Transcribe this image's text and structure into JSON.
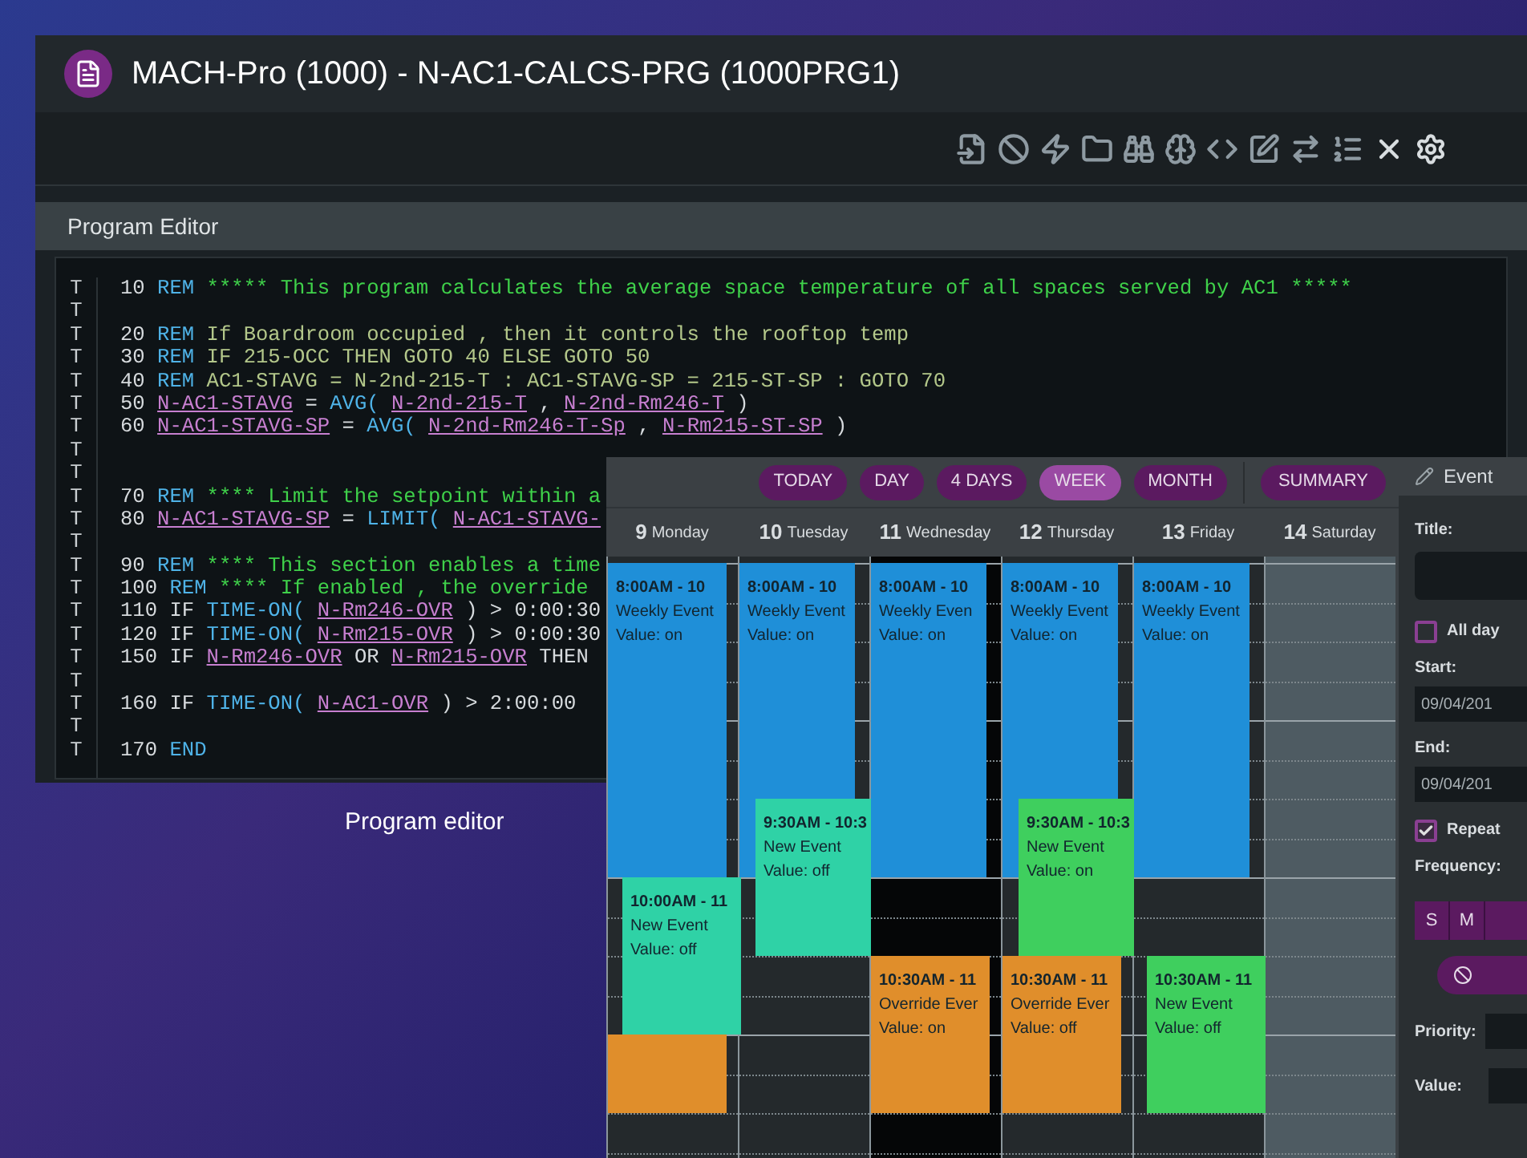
{
  "editor_window": {
    "title": "MACH-Pro (1000) - N-AC1-CALCS-PRG (1000PRG1)",
    "panel_title": "Program Editor",
    "lines": [
      {
        "gutter": "T",
        "segments": [
          {
            "kind": "num",
            "text": "10"
          },
          {
            "kind": "kw",
            "text": "REM"
          },
          {
            "kind": "comment",
            "text": "***** This program calculates the average space temperature of all spaces served by AC1 *****"
          }
        ]
      },
      {
        "gutter": "T"
      },
      {
        "gutter": "T",
        "segments": [
          {
            "kind": "num",
            "text": "20"
          },
          {
            "kind": "kw",
            "text": "REM"
          },
          {
            "kind": "muted",
            "text": "If Boardroom occupied , then it controls the rooftop temp"
          }
        ]
      },
      {
        "gutter": "T",
        "segments": [
          {
            "kind": "num",
            "text": "30"
          },
          {
            "kind": "kw",
            "text": "REM"
          },
          {
            "kind": "muted",
            "text": "IF 215-OCC THEN GOTO 40 ELSE GOTO 50"
          }
        ]
      },
      {
        "gutter": "T",
        "segments": [
          {
            "kind": "num",
            "text": "40"
          },
          {
            "kind": "kw",
            "text": "REM"
          },
          {
            "kind": "muted",
            "text": "AC1-STAVG = N-2nd-215-T : AC1-STAVG-SP = 215-ST-SP : GOTO 70"
          }
        ]
      },
      {
        "gutter": "T",
        "segments": [
          {
            "kind": "num",
            "text": "50"
          },
          {
            "kind": "var",
            "text": "N-AC1-STAVG"
          },
          {
            "kind": "op",
            "text": "="
          },
          {
            "kind": "fn",
            "text": "AVG("
          },
          {
            "kind": "var",
            "text": "N-2nd-215-T"
          },
          {
            "kind": "op",
            "text": ","
          },
          {
            "kind": "var",
            "text": "N-2nd-Rm246-T"
          },
          {
            "kind": "op",
            "text": ")"
          }
        ]
      },
      {
        "gutter": "T",
        "segments": [
          {
            "kind": "num",
            "text": "60"
          },
          {
            "kind": "var",
            "text": "N-AC1-STAVG-SP"
          },
          {
            "kind": "op",
            "text": "="
          },
          {
            "kind": "fn",
            "text": "AVG("
          },
          {
            "kind": "var",
            "text": "N-2nd-Rm246-T-Sp"
          },
          {
            "kind": "op",
            "text": ","
          },
          {
            "kind": "var",
            "text": "N-Rm215-ST-SP"
          },
          {
            "kind": "op",
            "text": ")"
          }
        ]
      },
      {
        "gutter": "T"
      },
      {
        "gutter": "T"
      },
      {
        "gutter": "T",
        "segments": [
          {
            "kind": "num",
            "text": "70"
          },
          {
            "kind": "kw",
            "text": "REM"
          },
          {
            "kind": "comment",
            "text": "**** Limit the setpoint within a"
          }
        ]
      },
      {
        "gutter": "T",
        "segments": [
          {
            "kind": "num",
            "text": "80"
          },
          {
            "kind": "var",
            "text": "N-AC1-STAVG-SP"
          },
          {
            "kind": "op",
            "text": "="
          },
          {
            "kind": "fn",
            "text": "LIMIT("
          },
          {
            "kind": "var",
            "text": "N-AC1-STAVG-"
          }
        ]
      },
      {
        "gutter": "T"
      },
      {
        "gutter": "T",
        "segments": [
          {
            "kind": "num",
            "text": "90"
          },
          {
            "kind": "kw",
            "text": "REM"
          },
          {
            "kind": "comment",
            "text": "**** This section enables a time"
          }
        ]
      },
      {
        "gutter": "T",
        "segments": [
          {
            "kind": "num",
            "text": "100"
          },
          {
            "kind": "kw",
            "text": "REM"
          },
          {
            "kind": "comment",
            "text": "**** If enabled , the override"
          }
        ]
      },
      {
        "gutter": "T",
        "segments": [
          {
            "kind": "num",
            "text": "110"
          },
          {
            "kind": "op",
            "text": "IF"
          },
          {
            "kind": "fn",
            "text": "TIME-ON("
          },
          {
            "kind": "var",
            "text": "N-Rm246-OVR"
          },
          {
            "kind": "op",
            "text": ") > 0:00:30"
          }
        ]
      },
      {
        "gutter": "T",
        "segments": [
          {
            "kind": "num",
            "text": "120"
          },
          {
            "kind": "op",
            "text": "IF"
          },
          {
            "kind": "fn",
            "text": "TIME-ON("
          },
          {
            "kind": "var",
            "text": "N-Rm215-OVR"
          },
          {
            "kind": "op",
            "text": ") > 0:00:30"
          }
        ]
      },
      {
        "gutter": "T",
        "segments": [
          {
            "kind": "num",
            "text": "150"
          },
          {
            "kind": "op",
            "text": "IF"
          },
          {
            "kind": "var",
            "text": "N-Rm246-OVR"
          },
          {
            "kind": "op",
            "text": "OR"
          },
          {
            "kind": "var",
            "text": "N-Rm215-OVR"
          },
          {
            "kind": "op",
            "text": "THEN"
          }
        ]
      },
      {
        "gutter": "T"
      },
      {
        "gutter": "T",
        "segments": [
          {
            "kind": "num",
            "text": "160"
          },
          {
            "kind": "op",
            "text": "IF"
          },
          {
            "kind": "fn",
            "text": "TIME-ON("
          },
          {
            "kind": "var",
            "text": "N-AC1-OVR"
          },
          {
            "kind": "op",
            "text": ") > 2:00:00"
          }
        ]
      },
      {
        "gutter": "T"
      },
      {
        "gutter": "T",
        "segments": [
          {
            "kind": "num",
            "text": "170"
          },
          {
            "kind": "kw",
            "text": "END"
          }
        ]
      }
    ]
  },
  "caption": "Program editor",
  "calendar": {
    "views": [
      {
        "label": "TODAY",
        "selected": false
      },
      {
        "label": "DAY",
        "selected": false
      },
      {
        "label": "4 DAYS",
        "selected": false
      },
      {
        "label": "WEEK",
        "selected": true
      },
      {
        "label": "MONTH",
        "selected": false
      }
    ],
    "summary_button": "SUMMARY",
    "days": [
      {
        "number": "9",
        "name": "Monday",
        "today": false,
        "weekend": false,
        "events": [
          {
            "time": "8:00AM - 10",
            "title": "Weekly Event",
            "value": "Value: on",
            "color": "#1f8fd8"
          },
          {
            "color": "#e08e2b"
          },
          {
            "time": "10:00AM - 11",
            "title": "New Event",
            "value": "Value: off",
            "color": "#2fd2a6"
          }
        ]
      },
      {
        "number": "10",
        "name": "Tuesday",
        "today": false,
        "weekend": false,
        "events": [
          {
            "time": "8:00AM - 10",
            "title": "Weekly Event",
            "value": "Value: on",
            "color": "#1f8fd8"
          },
          {
            "time": "9:30AM - 10:3",
            "title": "New Event",
            "value": "Value: off",
            "color": "#2fd2a6"
          }
        ]
      },
      {
        "number": "11",
        "name": "Wednesday",
        "today": true,
        "weekend": false,
        "events": [
          {
            "time": "8:00AM - 10",
            "title": "Weekly Even",
            "value": "Value: on",
            "color": "#1f8fd8"
          },
          {
            "time": "10:30AM - 11",
            "title": "Override Ever",
            "value": "Value: on",
            "color": "#e08e2b"
          }
        ]
      },
      {
        "number": "12",
        "name": "Thursday",
        "today": false,
        "weekend": false,
        "events": [
          {
            "time": "8:00AM - 10",
            "title": "Weekly Event",
            "value": "Value: on",
            "color": "#1f8fd8"
          },
          {
            "time": "9:30AM - 10:3",
            "title": "New Event",
            "value": "Value: on",
            "color": "#3fcf5e"
          },
          {
            "time": "10:30AM - 11",
            "title": "Override Ever",
            "value": "Value: off",
            "color": "#e08e2b"
          }
        ]
      },
      {
        "number": "13",
        "name": "Friday",
        "today": false,
        "weekend": false,
        "events": [
          {
            "time": "8:00AM - 10",
            "title": "Weekly Event",
            "value": "Value: on",
            "color": "#1f8fd8"
          },
          {
            "time": "10:30AM - 11",
            "title": "New Event",
            "value": "Value: off",
            "color": "#3fcf5e"
          }
        ]
      },
      {
        "number": "14",
        "name": "Saturday",
        "today": false,
        "weekend": true
      }
    ]
  },
  "event_form": {
    "title": "Event",
    "title_label": "Title:",
    "all_day": {
      "label": "All day",
      "checked": false
    },
    "start_label": "Start:",
    "start_value": "09/04/201",
    "end_label": "End:",
    "end_value": "09/04/201",
    "repeat": {
      "label": "Repeat",
      "checked": true
    },
    "frequency_label": "Frequency:",
    "weekdays": [
      {
        "label": "S"
      },
      {
        "label": "M"
      }
    ],
    "priority_label": "Priority:",
    "value_label": "Value:"
  }
}
